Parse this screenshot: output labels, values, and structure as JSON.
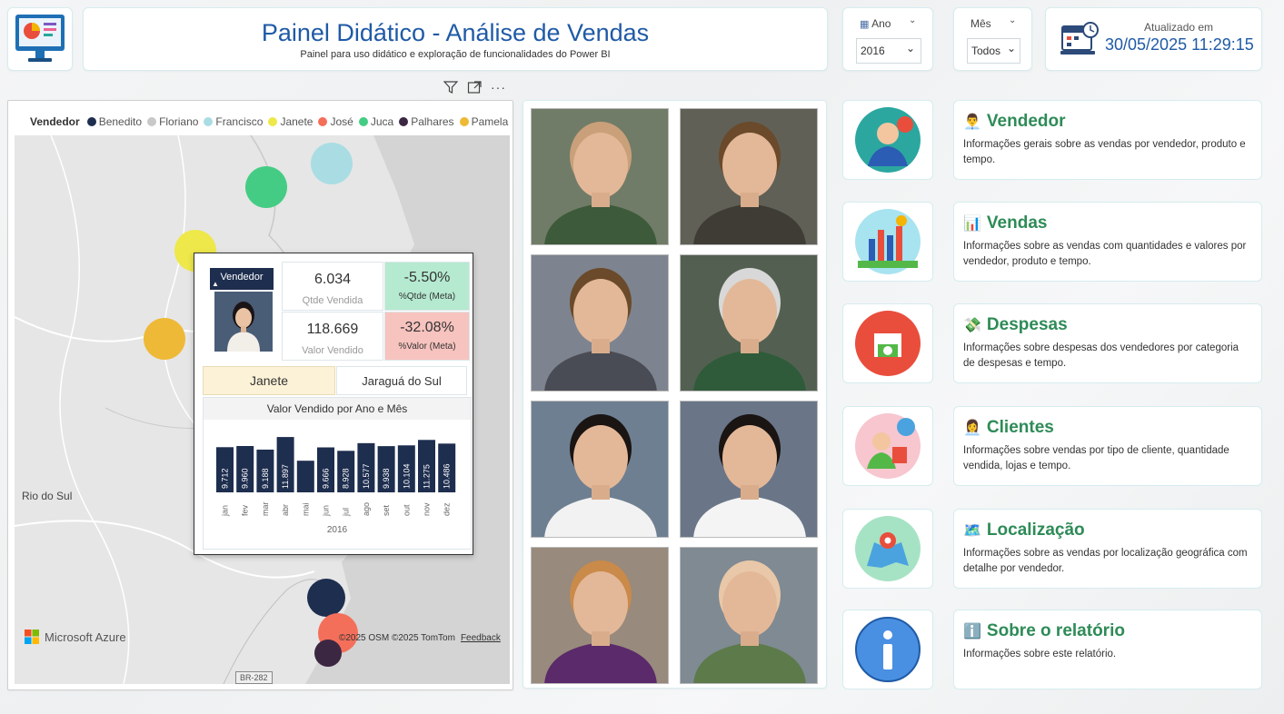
{
  "header": {
    "title": "Painel Didático - Análise de Vendas",
    "subtitle": "Painel para uso didático e exploração de funcionalidades do Power BI"
  },
  "slicers": {
    "ano": {
      "label": "Ano",
      "value": "2016"
    },
    "mes": {
      "label": "Mês",
      "value": "Todos"
    }
  },
  "updated": {
    "label": "Atualizado em",
    "value": "30/05/2025 11:29:15"
  },
  "map": {
    "legend_title": "Vendedor",
    "legend": [
      {
        "name": "Benedito",
        "color": "#1e2e4f"
      },
      {
        "name": "Floriano",
        "color": "#c8c8c8"
      },
      {
        "name": "Francisco",
        "color": "#a9dde3"
      },
      {
        "name": "Janete",
        "color": "#eee84a"
      },
      {
        "name": "José",
        "color": "#f46f5a"
      },
      {
        "name": "Juca",
        "color": "#45cc84"
      },
      {
        "name": "Palhares",
        "color": "#3c2742"
      },
      {
        "name": "Pamela",
        "color": "#eeb936"
      }
    ],
    "city_label": "Rio do Sul",
    "road_label": "BR-282",
    "brand": "Microsoft Azure",
    "attribution": "©2025 OSM  ©2025 TomTom",
    "feedback": "Feedback"
  },
  "tooltip": {
    "vendedor_label": "Vendedor",
    "qtde_value": "6.034",
    "qtde_label": "Qtde Vendida",
    "qtde_meta_value": "-5.50%",
    "qtde_meta_label": "%Qtde (Meta)",
    "valor_value": "118.669",
    "valor_label": "Valor Vendido",
    "valor_meta_value": "-32.08%",
    "valor_meta_label": "%Valor (Meta)",
    "name": "Janete",
    "city": "Jaraguá do Sul",
    "qtde_meta_color": "#b5ead0",
    "valor_meta_color": "#f7c3be"
  },
  "chart_data": {
    "type": "bar",
    "title": "Valor Vendido por Ano e Mês",
    "categories": [
      "jan",
      "fev",
      "mar",
      "abr",
      "mai",
      "jun",
      "jul",
      "ago",
      "set",
      "out",
      "nov",
      "dez"
    ],
    "values": [
      9712,
      9960,
      9188,
      11897,
      6800,
      9666,
      8928,
      10577,
      9938,
      10104,
      11275,
      10486
    ],
    "labels": [
      "9.712",
      "9.960",
      "9.188",
      "11.897",
      "",
      "9.666",
      "8.928",
      "10.577",
      "9.938",
      "10.104",
      "11.275",
      "10.486"
    ],
    "xlabel": "2016",
    "bar_color": "#1e2e4f"
  },
  "nav": [
    {
      "icon": "👨‍💼",
      "title": "Vendedor",
      "desc": "Informações gerais sobre as vendas por vendedor, produto e tempo."
    },
    {
      "icon": "📊",
      "title": "Vendas",
      "desc": "Informações sobre as vendas com quantidades e valores por vendedor, produto e tempo."
    },
    {
      "icon": "💸",
      "title": "Despesas",
      "desc": "Informações sobre despesas dos vendedores por categoria de despesas e tempo."
    },
    {
      "icon": "👩‍💼",
      "title": "Clientes",
      "desc": "Informações sobre vendas por tipo de cliente, quantidade vendida, lojas e tempo."
    },
    {
      "icon": "🗺️",
      "title": "Localização",
      "desc": "Informações sobre as vendas por localização geográfica com detalhe por vendedor."
    },
    {
      "icon": "ℹ️",
      "title": "Sobre o relatório",
      "desc": "Informações sobre este relatório."
    }
  ]
}
